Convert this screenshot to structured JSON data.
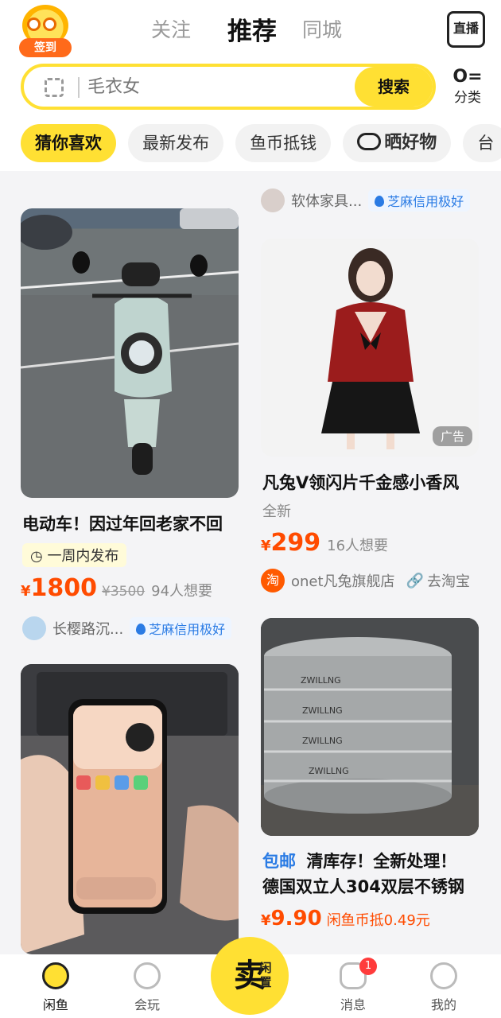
{
  "header": {
    "signin_label": "签到",
    "tabs": [
      {
        "label": "关注"
      },
      {
        "label": "推荐"
      },
      {
        "label": "同城"
      }
    ],
    "live_label": "直播",
    "category_label": "分类",
    "search": {
      "placeholder": "毛衣女",
      "button": "搜索"
    },
    "chips": [
      {
        "label": "猜你喜欢"
      },
      {
        "label": "最新发布"
      },
      {
        "label": "鱼币抵钱"
      },
      {
        "label": "晒好物"
      },
      {
        "label": "台"
      }
    ]
  },
  "feed": {
    "left": [
      {
        "title": "电动车！因过年回老家不回",
        "time_tag": "一周内发布",
        "price": "1800",
        "orig_price": "¥3500",
        "want": "94人想要",
        "colors": {
          "image_top": "#6b6f70"
        }
      },
      {
        "seller": "长樱路沉...",
        "credit": "芝麻信用极好"
      }
    ],
    "right": [
      {
        "seller": "软体家具...",
        "credit": "芝麻信用极好",
        "title": "凡兔V领闪片千金感小香风",
        "condition": "全新",
        "price": "299",
        "want": "16人想要",
        "shop": "onet凡兔旗舰店",
        "shop_link": "去淘宝",
        "ad_label": "广告"
      },
      {
        "free_ship": "包邮",
        "title_line1": "清库存！全新处理！",
        "title_line2": "德国双立人304双层不锈钢",
        "price": "9.90",
        "coin": "闲鱼币抵0.49元"
      }
    ]
  },
  "bottomnav": {
    "items": [
      {
        "label": "闲鱼"
      },
      {
        "label": "会玩"
      },
      {
        "label": "消息"
      },
      {
        "label": "我的"
      }
    ],
    "sell_label": "卖",
    "sell_sub": "闲置",
    "message_badge": "1"
  },
  "colors": {
    "accent": "#ffe033",
    "price": "#ff4b00",
    "credit": "#2a7be4"
  }
}
